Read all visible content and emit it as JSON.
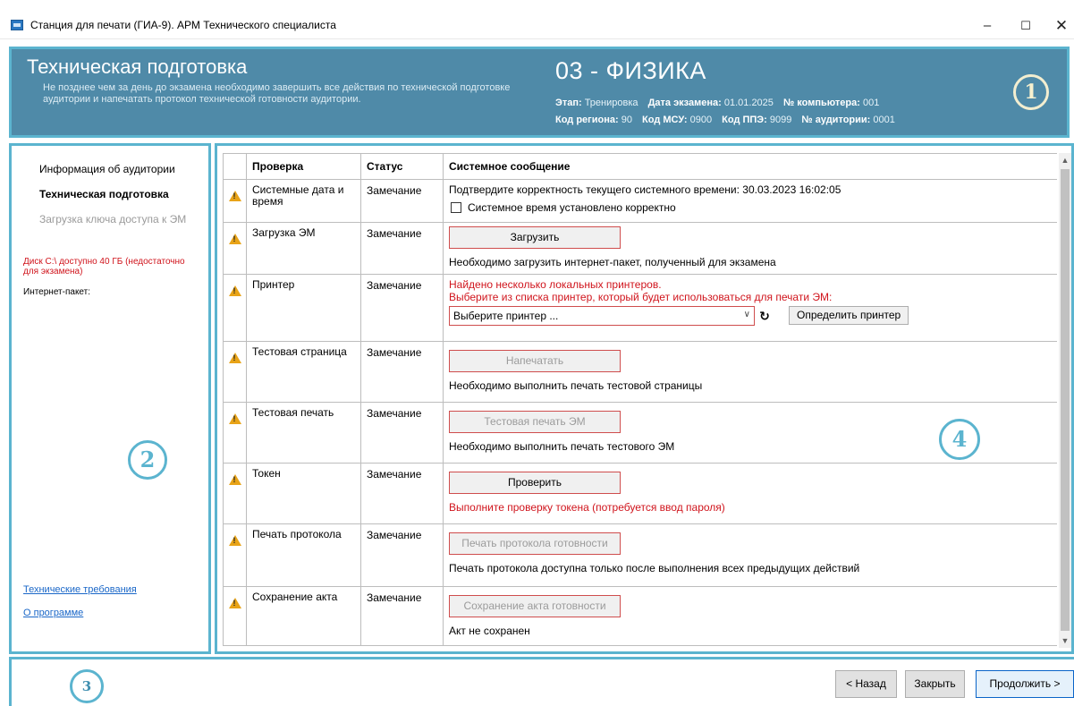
{
  "window": {
    "title": "Станция для печати (ГИА-9). АРМ Технического специалиста",
    "minimize": "–",
    "maximize": "☐",
    "close": "✕"
  },
  "header": {
    "title": "Техническая подготовка",
    "description": "Не позднее чем за день до экзамена необходимо завершить все действия по технической подготовке аудитории и напечатать протокол технической готовности аудитории.",
    "subject": "03 - ФИЗИКА",
    "stage_label": "Этап:",
    "stage_value": "Тренировка",
    "exam_date_label": "Дата экзамена:",
    "exam_date_value": "01.01.2025",
    "computer_label": "№ компьютера:",
    "computer_value": "001",
    "region_label": "Код региона:",
    "region_value": "90",
    "msu_label": "Код МСУ:",
    "msu_value": "0900",
    "ppe_label": "Код ППЭ:",
    "ppe_value": "9099",
    "room_label": "№ аудитории:",
    "room_value": "0001"
  },
  "badges": {
    "one": "1",
    "two": "2",
    "three": "3",
    "four": "4"
  },
  "sidebar": {
    "items": [
      {
        "label": "Информация об аудитории"
      },
      {
        "label": "Техническая подготовка"
      },
      {
        "label": "Загрузка ключа доступа к ЭМ"
      }
    ],
    "disk_status": "Диск C:\\ доступно 40 ГБ (недостаточно для экзамена)",
    "internet_package": "Интернет-пакет:",
    "link_requirements": "Технические требования",
    "link_about": "О программе"
  },
  "table": {
    "headers": {
      "check": "Проверка",
      "status": "Статус",
      "message": "Системное сообщение"
    },
    "rows": [
      {
        "check": "Системные дата и время",
        "status": "Замечание",
        "message": "Подтвердите корректность текущего системного времени: 30.03.2023 16:02:05",
        "checkbox_label": "Системное время установлено корректно"
      },
      {
        "check": "Загрузка ЭМ",
        "status": "Замечание",
        "button": "Загрузить",
        "message": "Необходимо загрузить интернет-пакет, полученный для экзамена"
      },
      {
        "check": "Принтер",
        "status": "Замечание",
        "message_line1": "Найдено несколько локальных принтеров.",
        "message_line2": "Выберите из списка принтер, который будет использоваться для печати ЭМ:",
        "select_value": "Выберите принтер ...",
        "detect_button": "Определить принтер"
      },
      {
        "check": "Тестовая страница",
        "status": "Замечание",
        "button": "Напечатать",
        "message": "Необходимо выполнить печать тестовой страницы"
      },
      {
        "check": "Тестовая печать",
        "status": "Замечание",
        "button": "Тестовая печать ЭМ",
        "message": "Необходимо выполнить печать тестового ЭМ"
      },
      {
        "check": "Токен",
        "status": "Замечание",
        "button": "Проверить",
        "message": "Выполните проверку токена (потребуется ввод пароля)"
      },
      {
        "check": "Печать протокола",
        "status": "Замечание",
        "button": "Печать протокола готовности",
        "message": "Печать протокола доступна только после выполнения всех предыдущих действий"
      },
      {
        "check": "Сохранение акта",
        "status": "Замечание",
        "button": "Сохранение акта готовности",
        "message": "Акт не сохранен"
      }
    ]
  },
  "footer": {
    "back": "< Назад",
    "close": "Закрыть",
    "next": "Продолжить >"
  },
  "colors": {
    "accent": "#5bb4cf",
    "header_bg": "#4f8aa8",
    "error": "#d0141c",
    "warning": "#e8a317",
    "link": "#1a67c8"
  }
}
